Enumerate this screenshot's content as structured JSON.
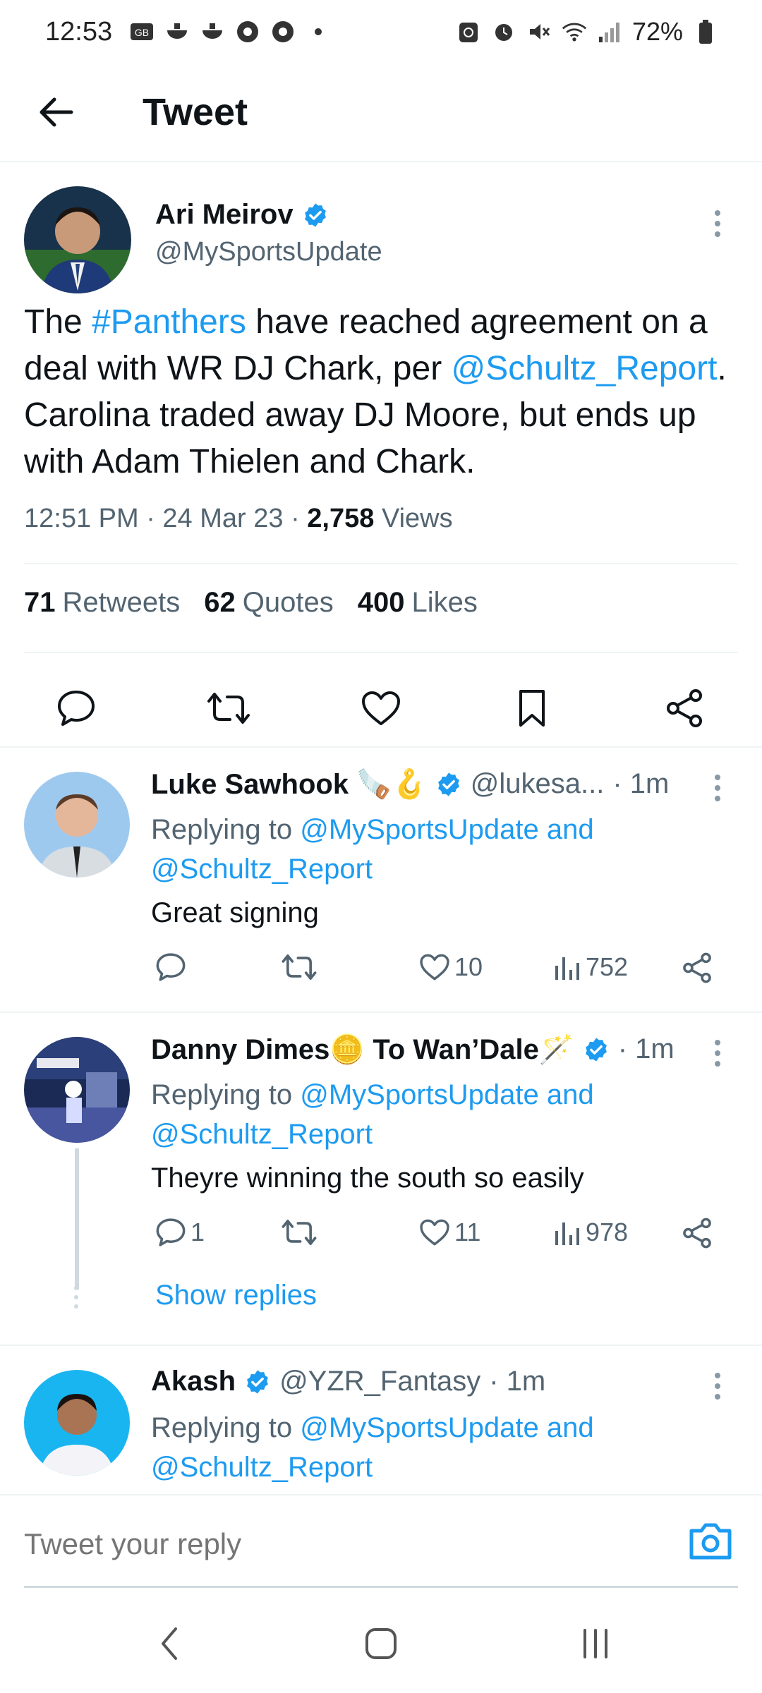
{
  "status_bar": {
    "time": "12:53",
    "battery": "72%"
  },
  "header": {
    "title": "Tweet"
  },
  "tweet": {
    "author_name": "Ari Meirov",
    "author_handle": "@MySportsUpdate",
    "text_parts": [
      "The ",
      "#Panthers",
      " have reached agreement on a deal with WR DJ Chark, per ",
      "@Schultz_Report",
      ". Carolina traded away DJ Moore, but ends up with Adam Thielen and Chark."
    ],
    "time": "12:51 PM · 24 Mar 23 · ",
    "views_count": "2,758",
    "views_label": " Views",
    "retweets_count": "71",
    "retweets_label": "Retweets",
    "quotes_count": "62",
    "quotes_label": "Quotes",
    "likes_count": "400",
    "likes_label": "Likes"
  },
  "replies": [
    {
      "name": "Luke Sawhook 🪚🪝",
      "handle": "@lukesa...",
      "time": "· 1m",
      "replying_prefix": "Replying to ",
      "replying_to": "@MySportsUpdate and",
      "replying_to_2": "@Schultz_Report",
      "text": "Great signing",
      "reply_count": "",
      "like_count": "10",
      "view_count": "752"
    },
    {
      "name": "Danny Dimes🪙 To Wan’Dale🪄",
      "handle": "",
      "time": "· 1m",
      "replying_prefix": "Replying to ",
      "replying_to": "@MySportsUpdate and",
      "replying_to_2": "@Schultz_Report",
      "text": "Theyre winning the south so easily",
      "reply_count": "1",
      "like_count": "11",
      "view_count": "978",
      "show_replies": "Show replies"
    },
    {
      "name": "Akash",
      "handle": "@YZR_Fantasy",
      "time": "· 1m",
      "replying_prefix": "Replying to ",
      "replying_to": "@MySportsUpdate and",
      "replying_to_2": "@Schultz_Report"
    }
  ],
  "composer": {
    "placeholder": "Tweet your reply"
  },
  "colors": {
    "accent": "#1d9bf0",
    "secondary_text": "#536471",
    "primary_text": "#0f1419"
  },
  "icons": [
    "back-arrow-icon",
    "verified-badge-icon",
    "more-vertical-icon",
    "reply-icon",
    "retweet-icon",
    "like-icon",
    "bookmark-icon",
    "share-icon",
    "views-icon",
    "camera-icon"
  ]
}
